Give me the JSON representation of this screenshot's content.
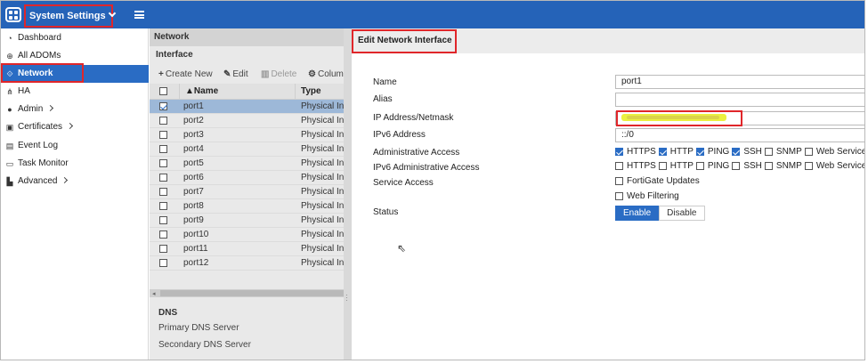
{
  "topbar": {
    "title": "System Settings"
  },
  "sidebar": {
    "items": [
      {
        "label": "Dashboard",
        "icon": "dashboard-icon",
        "glyph": "◔"
      },
      {
        "label": "All ADOMs",
        "icon": "globe-icon",
        "glyph": "⊕"
      },
      {
        "label": "Network",
        "icon": "network-icon",
        "glyph": "⟐",
        "active": true
      },
      {
        "label": "HA",
        "icon": "ha-icon",
        "glyph": "⋔"
      },
      {
        "label": "Admin",
        "icon": "admin-icon",
        "glyph": "●"
      },
      {
        "label": "Certificates",
        "icon": "certificate-icon",
        "glyph": "▣"
      },
      {
        "label": "Event Log",
        "icon": "event-log-icon",
        "glyph": "▤"
      },
      {
        "label": "Task Monitor",
        "icon": "task-monitor-icon",
        "glyph": "▭"
      },
      {
        "label": "Advanced",
        "icon": "advanced-icon",
        "glyph": "▙"
      }
    ]
  },
  "network": {
    "title": "Network",
    "section": "Interface",
    "toolbar": {
      "create": "Create New",
      "edit": "Edit",
      "delete": "Delete",
      "column": "Column"
    },
    "columns": {
      "name": "Name",
      "type": "Type"
    },
    "rows": [
      {
        "name": "port1",
        "type": "Physical Interface",
        "selected": true
      },
      {
        "name": "port2",
        "type": "Physical Interface"
      },
      {
        "name": "port3",
        "type": "Physical Interface"
      },
      {
        "name": "port4",
        "type": "Physical Interface"
      },
      {
        "name": "port5",
        "type": "Physical Interface"
      },
      {
        "name": "port6",
        "type": "Physical Interface"
      },
      {
        "name": "port7",
        "type": "Physical Interface"
      },
      {
        "name": "port8",
        "type": "Physical Interface"
      },
      {
        "name": "port9",
        "type": "Physical Interface"
      },
      {
        "name": "port10",
        "type": "Physical Interface"
      },
      {
        "name": "port11",
        "type": "Physical Interface"
      },
      {
        "name": "port12",
        "type": "Physical Interface"
      }
    ],
    "dns": {
      "title": "DNS",
      "primary": "Primary DNS Server",
      "secondary": "Secondary DNS Server"
    }
  },
  "edit": {
    "title": "Edit Network Interface",
    "labels": {
      "name": "Name",
      "alias": "Alias",
      "ip": "IP Address/Netmask",
      "ipv6": "IPv6 Address",
      "admin_access": "Administrative Access",
      "ipv6_admin_access": "IPv6 Administrative Access",
      "service_access": "Service Access",
      "status": "Status"
    },
    "values": {
      "name": "port1",
      "alias": "",
      "ipv6": "::/0"
    },
    "admin_access": [
      {
        "label": "HTTPS",
        "checked": true
      },
      {
        "label": "HTTP",
        "checked": true
      },
      {
        "label": "PING",
        "checked": true
      },
      {
        "label": "SSH",
        "checked": true
      },
      {
        "label": "SNMP",
        "checked": false
      },
      {
        "label": "Web Service",
        "checked": false
      }
    ],
    "ipv6_admin_access": [
      {
        "label": "HTTPS",
        "checked": false
      },
      {
        "label": "HTTP",
        "checked": false
      },
      {
        "label": "PING",
        "checked": false
      },
      {
        "label": "SSH",
        "checked": false
      },
      {
        "label": "SNMP",
        "checked": false
      },
      {
        "label": "Web Service",
        "checked": false
      }
    ],
    "service_access": [
      {
        "label": "FortiGate Updates",
        "checked": false
      },
      {
        "label": "Web Filtering",
        "checked": false
      }
    ],
    "status": {
      "enable": "Enable",
      "disable": "Disable",
      "selected": "Enable"
    }
  },
  "colors": {
    "brand": "#2563b8",
    "active": "#2a6cc4",
    "highlight": "#e0262a"
  }
}
